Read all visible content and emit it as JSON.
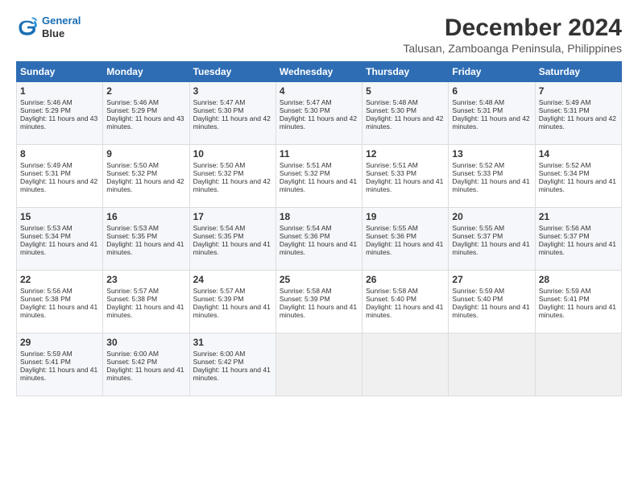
{
  "logo": {
    "line1": "General",
    "line2": "Blue"
  },
  "title": "December 2024",
  "subtitle": "Talusan, Zamboanga Peninsula, Philippines",
  "days_header": [
    "Sunday",
    "Monday",
    "Tuesday",
    "Wednesday",
    "Thursday",
    "Friday",
    "Saturday"
  ],
  "weeks": [
    [
      {
        "day": "1",
        "info": "Sunrise: 5:46 AM\nSunset: 5:29 PM\nDaylight: 11 hours and 43 minutes."
      },
      {
        "day": "2",
        "info": "Sunrise: 5:46 AM\nSunset: 5:29 PM\nDaylight: 11 hours and 43 minutes."
      },
      {
        "day": "3",
        "info": "Sunrise: 5:47 AM\nSunset: 5:30 PM\nDaylight: 11 hours and 42 minutes."
      },
      {
        "day": "4",
        "info": "Sunrise: 5:47 AM\nSunset: 5:30 PM\nDaylight: 11 hours and 42 minutes."
      },
      {
        "day": "5",
        "info": "Sunrise: 5:48 AM\nSunset: 5:30 PM\nDaylight: 11 hours and 42 minutes."
      },
      {
        "day": "6",
        "info": "Sunrise: 5:48 AM\nSunset: 5:31 PM\nDaylight: 11 hours and 42 minutes."
      },
      {
        "day": "7",
        "info": "Sunrise: 5:49 AM\nSunset: 5:31 PM\nDaylight: 11 hours and 42 minutes."
      }
    ],
    [
      {
        "day": "8",
        "info": "Sunrise: 5:49 AM\nSunset: 5:31 PM\nDaylight: 11 hours and 42 minutes."
      },
      {
        "day": "9",
        "info": "Sunrise: 5:50 AM\nSunset: 5:32 PM\nDaylight: 11 hours and 42 minutes."
      },
      {
        "day": "10",
        "info": "Sunrise: 5:50 AM\nSunset: 5:32 PM\nDaylight: 11 hours and 42 minutes."
      },
      {
        "day": "11",
        "info": "Sunrise: 5:51 AM\nSunset: 5:32 PM\nDaylight: 11 hours and 41 minutes."
      },
      {
        "day": "12",
        "info": "Sunrise: 5:51 AM\nSunset: 5:33 PM\nDaylight: 11 hours and 41 minutes."
      },
      {
        "day": "13",
        "info": "Sunrise: 5:52 AM\nSunset: 5:33 PM\nDaylight: 11 hours and 41 minutes."
      },
      {
        "day": "14",
        "info": "Sunrise: 5:52 AM\nSunset: 5:34 PM\nDaylight: 11 hours and 41 minutes."
      }
    ],
    [
      {
        "day": "15",
        "info": "Sunrise: 5:53 AM\nSunset: 5:34 PM\nDaylight: 11 hours and 41 minutes."
      },
      {
        "day": "16",
        "info": "Sunrise: 5:53 AM\nSunset: 5:35 PM\nDaylight: 11 hours and 41 minutes."
      },
      {
        "day": "17",
        "info": "Sunrise: 5:54 AM\nSunset: 5:35 PM\nDaylight: 11 hours and 41 minutes."
      },
      {
        "day": "18",
        "info": "Sunrise: 5:54 AM\nSunset: 5:36 PM\nDaylight: 11 hours and 41 minutes."
      },
      {
        "day": "19",
        "info": "Sunrise: 5:55 AM\nSunset: 5:36 PM\nDaylight: 11 hours and 41 minutes."
      },
      {
        "day": "20",
        "info": "Sunrise: 5:55 AM\nSunset: 5:37 PM\nDaylight: 11 hours and 41 minutes."
      },
      {
        "day": "21",
        "info": "Sunrise: 5:56 AM\nSunset: 5:37 PM\nDaylight: 11 hours and 41 minutes."
      }
    ],
    [
      {
        "day": "22",
        "info": "Sunrise: 5:56 AM\nSunset: 5:38 PM\nDaylight: 11 hours and 41 minutes."
      },
      {
        "day": "23",
        "info": "Sunrise: 5:57 AM\nSunset: 5:38 PM\nDaylight: 11 hours and 41 minutes."
      },
      {
        "day": "24",
        "info": "Sunrise: 5:57 AM\nSunset: 5:39 PM\nDaylight: 11 hours and 41 minutes."
      },
      {
        "day": "25",
        "info": "Sunrise: 5:58 AM\nSunset: 5:39 PM\nDaylight: 11 hours and 41 minutes."
      },
      {
        "day": "26",
        "info": "Sunrise: 5:58 AM\nSunset: 5:40 PM\nDaylight: 11 hours and 41 minutes."
      },
      {
        "day": "27",
        "info": "Sunrise: 5:59 AM\nSunset: 5:40 PM\nDaylight: 11 hours and 41 minutes."
      },
      {
        "day": "28",
        "info": "Sunrise: 5:59 AM\nSunset: 5:41 PM\nDaylight: 11 hours and 41 minutes."
      }
    ],
    [
      {
        "day": "29",
        "info": "Sunrise: 5:59 AM\nSunset: 5:41 PM\nDaylight: 11 hours and 41 minutes."
      },
      {
        "day": "30",
        "info": "Sunrise: 6:00 AM\nSunset: 5:42 PM\nDaylight: 11 hours and 41 minutes."
      },
      {
        "day": "31",
        "info": "Sunrise: 6:00 AM\nSunset: 5:42 PM\nDaylight: 11 hours and 41 minutes."
      },
      null,
      null,
      null,
      null
    ]
  ]
}
